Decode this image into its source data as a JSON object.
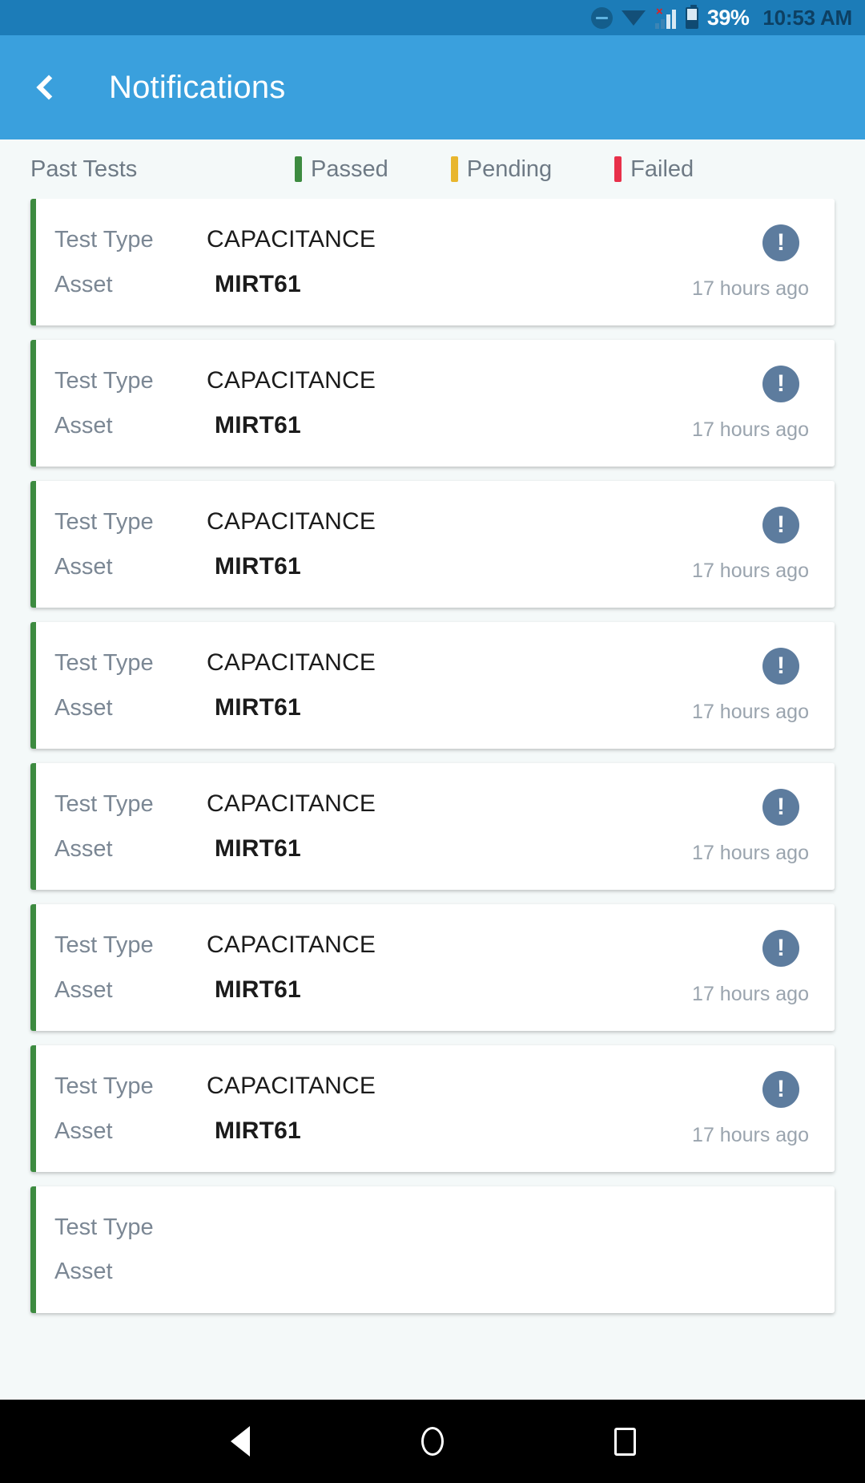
{
  "status_bar": {
    "dnd_icon": "do-not-disturb-icon",
    "wifi_icon": "wifi-icon",
    "signal_icon": "cellular-signal-no-service-icon",
    "signal_x": "×",
    "battery_icon": "battery-icon",
    "battery_percent": "39%",
    "clock": "10:53 AM"
  },
  "app_bar": {
    "back_icon": "chevron-left-icon",
    "title": "Notifications"
  },
  "legend": {
    "title": "Past Tests",
    "items": [
      {
        "label": "Passed",
        "color": "#3d8b40"
      },
      {
        "label": "Pending",
        "color": "#e8b62e"
      },
      {
        "label": "Failed",
        "color": "#e8304a"
      }
    ]
  },
  "list": {
    "label_test_type": "Test Type",
    "label_asset": "Asset",
    "badge_symbol": "!",
    "badge_color": "#5d7c9e",
    "cards": [
      {
        "status": "passed",
        "accent": "#3d8b40",
        "test_type": "CAPACITANCE",
        "asset": "MIRT61",
        "time_ago": "17 hours ago"
      },
      {
        "status": "passed",
        "accent": "#3d8b40",
        "test_type": "CAPACITANCE",
        "asset": "MIRT61",
        "time_ago": "17 hours ago"
      },
      {
        "status": "passed",
        "accent": "#3d8b40",
        "test_type": "CAPACITANCE",
        "asset": "MIRT61",
        "time_ago": "17 hours ago"
      },
      {
        "status": "passed",
        "accent": "#3d8b40",
        "test_type": "CAPACITANCE",
        "asset": "MIRT61",
        "time_ago": "17 hours ago"
      },
      {
        "status": "passed",
        "accent": "#3d8b40",
        "test_type": "CAPACITANCE",
        "asset": "MIRT61",
        "time_ago": "17 hours ago"
      },
      {
        "status": "passed",
        "accent": "#3d8b40",
        "test_type": "CAPACITANCE",
        "asset": "MIRT61",
        "time_ago": "17 hours ago"
      },
      {
        "status": "passed",
        "accent": "#3d8b40",
        "test_type": "CAPACITANCE",
        "asset": "MIRT61",
        "time_ago": "17 hours ago"
      },
      {
        "status": "passed",
        "accent": "#3d8b40",
        "test_type": "",
        "asset": "",
        "time_ago": ""
      }
    ]
  },
  "nav_bar": {
    "back_icon": "triangle-back-icon",
    "home_icon": "circle-home-icon",
    "recents_icon": "square-recents-icon"
  }
}
